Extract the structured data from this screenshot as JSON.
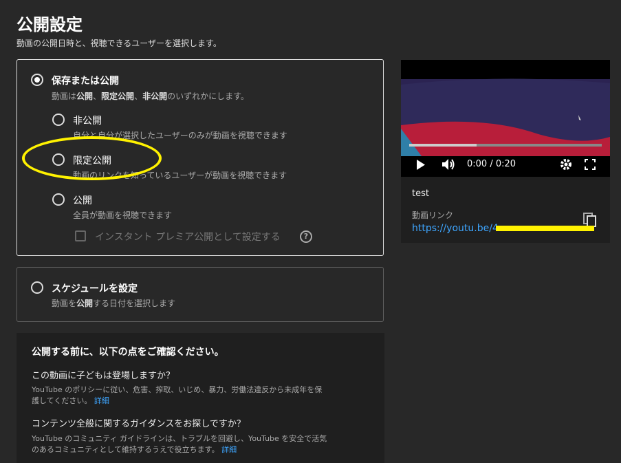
{
  "header": {
    "title": "公開設定",
    "subtitle": "動画の公開日時と、視聴できるユーザーを選択します。"
  },
  "save_publish": {
    "label": "保存または公開",
    "desc_parts": [
      "動画は",
      "公開",
      "、",
      "限定公開",
      "、",
      "非公開",
      "のいずれかにします。"
    ],
    "options": [
      {
        "label": "非公開",
        "desc": "自分と自分が選択したユーザーのみが動画を視聴できます"
      },
      {
        "label": "限定公開",
        "desc": "動画のリンクを知っているユーザーが動画を視聴できます"
      },
      {
        "label": "公開",
        "desc": "全員が動画を視聴できます"
      }
    ],
    "premiere_label": "インスタント プレミア公開として設定する",
    "help_glyph": "?"
  },
  "schedule": {
    "label": "スケジュールを設定",
    "desc_parts": [
      "動画を",
      "公開",
      "する日付を選択します"
    ]
  },
  "checklist": {
    "heading": "公開する前に、以下の点をご確認ください。",
    "items": [
      {
        "question": "この動画に子どもは登場しますか？",
        "text": "YouTube のポリシーに従い、危害、搾取、いじめ、暴力、労働法違反から未成年を保護してください。",
        "link": "詳細"
      },
      {
        "question": "コンテンツ全般に関するガイダンスをお探しですか？",
        "text": "YouTube のコミュニティ ガイドラインは、トラブルを回避し、YouTube を安全で活気のあるコミュニティとして維持するうえで役立ちます。",
        "link": "詳細"
      }
    ]
  },
  "video": {
    "time": "0:00 / 0:20",
    "title": "test",
    "link_label": "動画リンク",
    "link_url": "https://youtu.be/4n",
    "progress_fraction": 0.35
  },
  "colors": {
    "accent_link": "#3ea6ff",
    "highlight": "#fff200"
  }
}
